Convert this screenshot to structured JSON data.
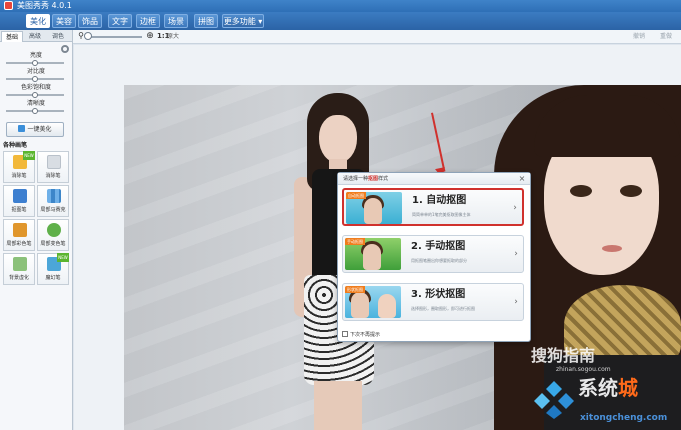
{
  "window": {
    "title": "美图秀秀 4.0.1"
  },
  "tabs": [
    {
      "label": "美化",
      "active": true
    },
    {
      "label": "美容",
      "active": false
    },
    {
      "label": "饰品",
      "active": false
    },
    {
      "label": "文字",
      "active": false
    },
    {
      "label": "边框",
      "active": false
    },
    {
      "label": "场景",
      "active": false
    },
    {
      "label": "拼图",
      "active": false
    },
    {
      "label": "更多功能 ▾",
      "active": false
    }
  ],
  "toolbar": {
    "zoom_actual": "1:1",
    "zoom_label": "原大",
    "undo_label": "撤销",
    "redo_label": "重做"
  },
  "left_panel": {
    "subtabs": [
      {
        "label": "基础"
      },
      {
        "label": "高级"
      },
      {
        "label": "调色"
      }
    ],
    "sliders": [
      {
        "label": "亮度",
        "value": 0.5
      },
      {
        "label": "对比度",
        "value": 0.5
      },
      {
        "label": "色彩饱和度",
        "value": 0.5
      },
      {
        "label": "清晰度",
        "value": 0.5
      }
    ],
    "beautify_button": "一键美化",
    "section_title": "各种画笔",
    "tools": [
      {
        "label": "消除笔",
        "icon": "eraser-pen-icon",
        "badge": "NEW"
      },
      {
        "label": "消除笔",
        "icon": "eraser-icon"
      },
      {
        "label": "抠图笔",
        "icon": "cutout-pen-icon"
      },
      {
        "label": "局部马赛克",
        "icon": "mosaic-icon"
      },
      {
        "label": "局部彩色笔",
        "icon": "color-brush-icon"
      },
      {
        "label": "局部变色笔",
        "icon": "recolor-brush-icon"
      },
      {
        "label": "背景虚化",
        "icon": "blur-background-icon"
      },
      {
        "label": "魔幻笔",
        "icon": "magic-pen-icon",
        "badge": "NEW"
      }
    ]
  },
  "dialog": {
    "title_prefix": "请选择一种",
    "title_em": "抠图",
    "title_suffix": "样式",
    "options": [
      {
        "tag": "自动抠图",
        "title": "1. 自动抠图",
        "desc": "简简单单的1笔完美抠取图像主体",
        "selected": true
      },
      {
        "tag": "手动抠图",
        "title": "2. 手动抠图",
        "desc": "用抠图笔圈出你想要抠取的部分",
        "selected": false
      },
      {
        "tag": "形状抠图",
        "title": "3. 形状抠图",
        "desc": "选择图形，圈取图形，即可进行抠图",
        "selected": false
      }
    ],
    "dont_show_again": "下次不再提示"
  },
  "watermarks": {
    "sogou": "搜狗指南",
    "sogou_sub": "zhinan.sogou.com",
    "site_cn_a": "系统",
    "site_cn_b": "城",
    "site_domain": "xitongcheng.com"
  },
  "colors": {
    "brand_blue": "#2e6fb6",
    "accent_red": "#d0312d",
    "tag_orange": "#f07d1d"
  }
}
